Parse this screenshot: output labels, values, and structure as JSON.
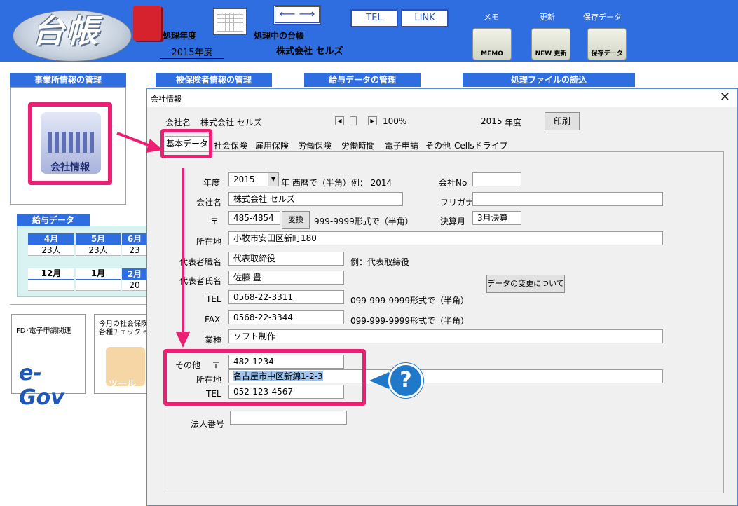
{
  "header": {
    "logo_text": "台帳",
    "processing_year_label": "処理年度",
    "processing_year_value": "2015年度",
    "processing_ledger_label": "処理中の台帳",
    "processing_ledger_value": "株式会社 セルズ",
    "tel_button": "TEL",
    "link_button": "LINK",
    "memo_label": "メモ",
    "memo_icon_text": "MEMO",
    "update_label": "更新",
    "update_icon_text": "NEW 更新",
    "backup_label": "保存データ",
    "backup_icon_text": "保存データ"
  },
  "sections": {
    "office": "事業所情報の管理",
    "insured": "被保険者情報の管理",
    "salary": "給与データの管理",
    "files": "処理ファイルの読込"
  },
  "company_icon_label": "会社情報",
  "salary_data": {
    "title": "給与データ",
    "row1": [
      {
        "month": "4月",
        "count": "23人"
      },
      {
        "month": "5月",
        "count": "23人"
      },
      {
        "month": "6月",
        "count": "23"
      }
    ],
    "row2": [
      {
        "month": "12月",
        "count": ""
      },
      {
        "month": "1月",
        "count": ""
      },
      {
        "month": "2月",
        "count": "20"
      }
    ]
  },
  "egov": {
    "text": "FD･電子申請関連",
    "logo": "e-Gov"
  },
  "tool": {
    "line1": "今月の社会保険",
    "line2": "各種チェック e",
    "caption": "ツール"
  },
  "dialog": {
    "title": "会社情報",
    "close": "✕",
    "company_label": "会社名",
    "company_value": "株式会社 セルズ",
    "zoom": "100%",
    "year_value": "2015",
    "year_unit": "年度",
    "print_button": "印刷",
    "tabs": [
      "基本データ",
      "社会保険",
      "雇用保険",
      "労働保険",
      "労働時間",
      "電子申請",
      "その他",
      "Cellsドライブ"
    ],
    "form": {
      "year_label": "年度",
      "year_value": "2015",
      "year_suffix": "年  西暦で（半角）例：  2014",
      "company_no_label": "会社No",
      "company_no_value": "",
      "name_label": "会社名",
      "name_value": "株式会社 セルズ",
      "furigana_label": "フリガナ",
      "furigana_value": "",
      "zip_label": "〒",
      "zip_value": "485-4854",
      "convert_button": "変換",
      "zip_hint": "999-9999形式で（半角）",
      "closing_label": "決算月",
      "closing_value": "3月決算",
      "address_label": "所在地",
      "address_value": "小牧市安田区新町180",
      "rep_title_label": "代表者職名",
      "rep_title_value": "代表取締役",
      "rep_title_hint": "例：代表取締役",
      "rep_name_label": "代表者氏名",
      "rep_name_value": "佐藤 豊",
      "data_change_button": "データの変更について",
      "tel_label": "TEL",
      "tel_value": "0568-22-3311",
      "tel_hint": "099-999-9999形式で（半角）",
      "fax_label": "FAX",
      "fax_value": "0568-22-3344",
      "fax_hint": "099-999-9999形式で（半角）",
      "business_label": "業種",
      "business_value": "ソフト制作",
      "other_label": "その他",
      "other_zip_label": "〒",
      "other_zip_value": "482-1234",
      "other_address_label": "所在地",
      "other_address_value": "名古屋市中区新錦1-2-3",
      "other_tel_label": "TEL",
      "other_tel_value": "052-123-4567",
      "corp_no_label": "法人番号",
      "corp_no_value": ""
    }
  },
  "help_icon": "?"
}
